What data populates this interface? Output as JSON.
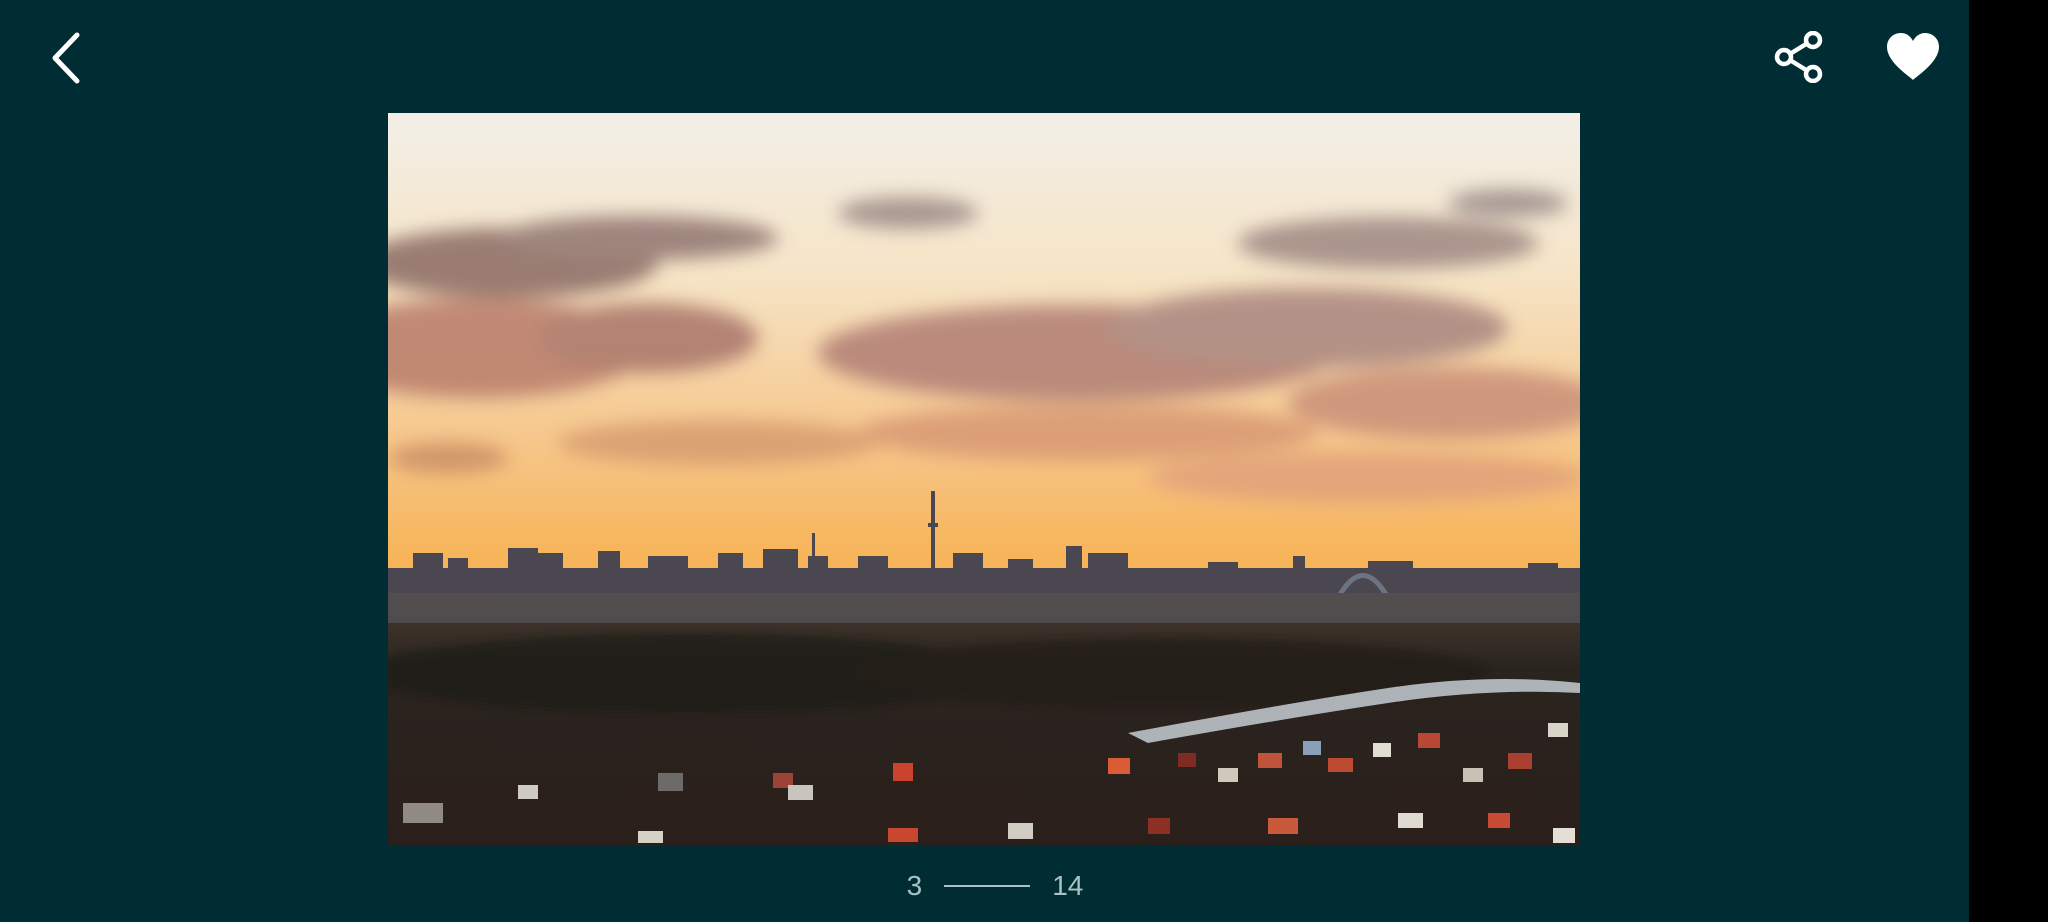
{
  "toolbar": {
    "back_icon": "chevron-left-icon",
    "share_icon": "share-icon",
    "favorite_icon": "heart-icon",
    "favorite_active": true
  },
  "pager": {
    "current": "3",
    "total": "14"
  },
  "colors": {
    "background": "#002d33",
    "icon": "#ffffff",
    "pager_text": "#a9c2c5"
  }
}
